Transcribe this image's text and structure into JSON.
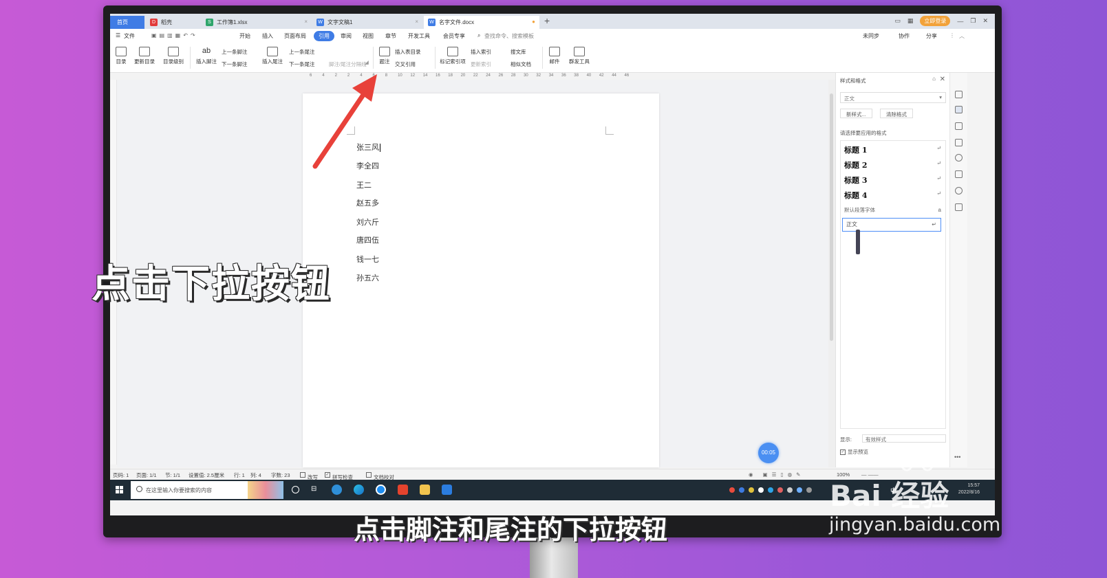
{
  "tabs": [
    {
      "label": "首页"
    },
    {
      "label": "稻壳"
    },
    {
      "label": "工作簿1.xlsx"
    },
    {
      "label": "文字文稿1"
    },
    {
      "label": "名字文件.docx"
    }
  ],
  "tab_right": {
    "login": "立即登录"
  },
  "menu": {
    "file": "文件",
    "items": [
      "开始",
      "插入",
      "页面布局",
      "引用",
      "审阅",
      "视图",
      "章节",
      "开发工具",
      "会员专享"
    ],
    "search": "查找命令、搜索模板",
    "right": [
      "未同步",
      "协作",
      "分享"
    ]
  },
  "ribbon": {
    "toc": "目录",
    "update_toc": "更新目录",
    "toc_level": "目录级别",
    "insert_footnote": "插入脚注",
    "prev_footnote": "上一条脚注",
    "next_footnote": "下一条脚注",
    "insert_endnote": "插入尾注",
    "prev_endnote": "上一条尾注",
    "next_endnote": "下一条尾注",
    "separator_line": "脚注/尾注分隔线",
    "caption": "题注",
    "insert_table_toc": "插入表目录",
    "cross_ref": "交叉引用",
    "mark_index": "标记索引项",
    "insert_index": "插入索引",
    "update_index": "更新索引",
    "search_lib": "搜文库",
    "similar_docs": "相似文档",
    "mail": "邮件",
    "mass_tool": "群发工具"
  },
  "ruler_ticks": [
    "6",
    "4",
    "2",
    "2",
    "4",
    "6",
    "8",
    "10",
    "12",
    "14",
    "16",
    "18",
    "20",
    "22",
    "24",
    "26",
    "28",
    "30",
    "32",
    "34",
    "36",
    "38",
    "40",
    "42",
    "44",
    "46"
  ],
  "document": {
    "lines": [
      "张三风",
      "李全四",
      "王二",
      "赵五多",
      "刘六斤",
      "唐四伍",
      "钱一七",
      "孙五六"
    ]
  },
  "panel": {
    "title": "样式和格式",
    "current_style": "正文",
    "new_style": "新样式...",
    "clear_format": "清除格式",
    "prompt": "请选择要应用的格式",
    "styles": [
      "标题 1",
      "标题 2",
      "标题 3",
      "标题 4"
    ],
    "default_font": "默认段落字体",
    "body": "正文",
    "show_label": "显示:",
    "show_value": "有效样式",
    "preview": "显示预览"
  },
  "timer": "00:05",
  "status": {
    "page_no": "页码: 1",
    "pages": "页面: 1/1",
    "section": "节: 1/1",
    "setting": "设置值: 2.5厘米",
    "row": "行: 1",
    "col": "列: 4",
    "words": "字数: 23",
    "overwrite": "改写",
    "spell": "拼写检查",
    "proof": "文档校对",
    "zoom": "100%"
  },
  "taskbar": {
    "search_placeholder": "在这里输入你要搜索的内容",
    "ime": "中",
    "time": "15:57",
    "date": "2022/8/16"
  },
  "overlay": {
    "instruction": "点击下拉按钮",
    "subtitle": "点击脚注和尾注的下拉按钮"
  },
  "watermark": {
    "logo": "Bai 经验",
    "url": "jingyan.baidu.com"
  },
  "colors": {
    "accent": "#3f7ce5",
    "arrow": "#e8413a",
    "background": "#b25ad8"
  }
}
